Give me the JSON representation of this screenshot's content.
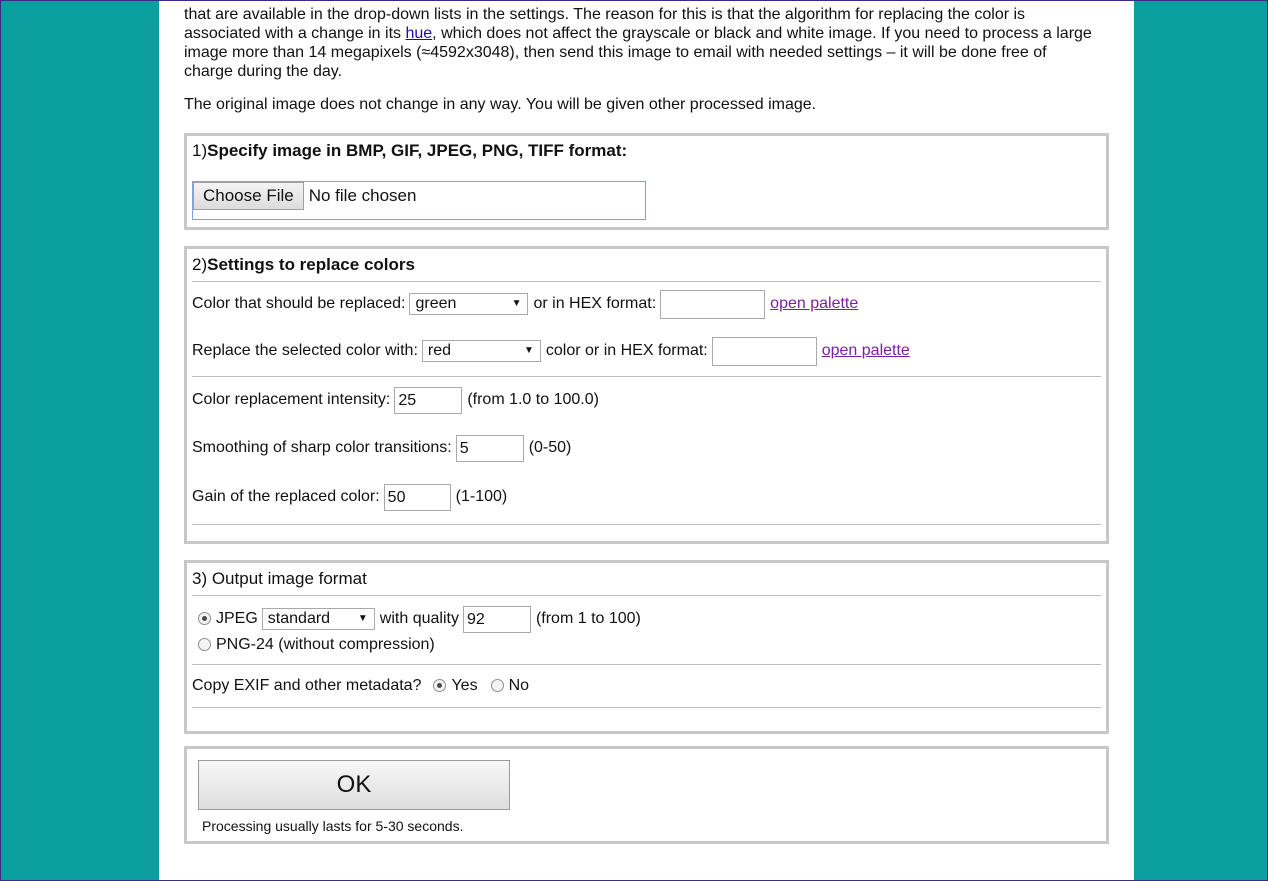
{
  "intro": {
    "line1": "that are available in the drop-down lists in the settings. The reason for this is that the algorithm for replacing the color is",
    "line2_before": "associated with a change in its ",
    "line2_link": "hue",
    "line2_after": ", which does not affect the grayscale or black and white image. If you need to process a large",
    "line3": "image more than 14 megapixels (≈4592x3048), then send this image to email with needed settings – it will be done free of",
    "line4": "charge during the day.",
    "note": "The original image does not change in any way. You will be given other processed image."
  },
  "section1": {
    "number": "1) ",
    "title": "Specify image in BMP, GIF, JPEG, PNG, TIFF format:",
    "choose_label": "Choose File",
    "no_file": "No file chosen"
  },
  "section2": {
    "number": "2) ",
    "title": "Settings to replace colors",
    "replace_label": "Color that should be replaced:",
    "replace_value": "green",
    "replace_hex_label": "or in HEX format:",
    "replace_hex_value": "",
    "palette_link": "open palette",
    "with_label": "Replace the selected color with:",
    "with_value": "red",
    "with_hex_label": "color or in HEX format:",
    "with_hex_value": "",
    "intensity_label": "Color replacement intensity:",
    "intensity_value": "25",
    "intensity_range": "(from 1.0 to 100.0)",
    "smoothing_label": "Smoothing of sharp color transitions:",
    "smoothing_value": "5",
    "smoothing_range": "(0-50)",
    "gain_label": "Gain of the replaced color:",
    "gain_value": "50",
    "gain_range": "(1-100)"
  },
  "section3": {
    "title": "3) Output image format",
    "jpeg_label": "JPEG",
    "jpeg_mode": "standard",
    "quality_label": "with quality",
    "quality_value": "92",
    "quality_range": "(from 1 to 100)",
    "png_label": "PNG-24 (without compression)",
    "exif_label": "Copy EXIF and other metadata?",
    "yes_label": "Yes",
    "no_label": "No"
  },
  "submit": {
    "ok_label": "OK",
    "note": "Processing usually lasts for 5-30 seconds."
  }
}
